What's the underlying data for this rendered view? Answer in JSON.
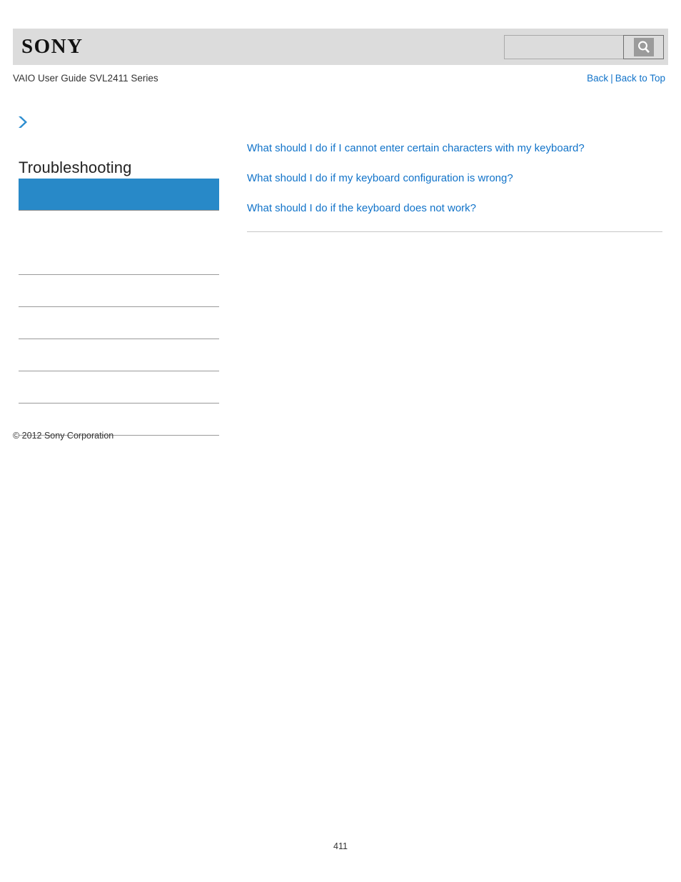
{
  "header": {
    "logo_text": "SONY",
    "logo_icon": "sony-wordmark",
    "search": {
      "value": "",
      "placeholder": "",
      "icon": "search-icon",
      "button_label": ""
    }
  },
  "subheader": {
    "guide_title": "VAIO User Guide SVL2411 Series",
    "back_label": "Back",
    "separator": "|",
    "back_to_top_label": "Back to Top"
  },
  "sidebar": {
    "breadcrumb_icon": "double-chevron-right-icon",
    "section_title": "Troubleshooting",
    "items": [
      {
        "label": "",
        "selected": true
      },
      {
        "label": "",
        "selected": false
      },
      {
        "label": "",
        "selected": false
      },
      {
        "label": "",
        "selected": false
      },
      {
        "label": "",
        "selected": false
      },
      {
        "label": "",
        "selected": false
      },
      {
        "label": "",
        "selected": false
      },
      {
        "label": "",
        "selected": false
      }
    ]
  },
  "main": {
    "links": [
      "What should I do if I cannot enter certain characters with my keyboard?",
      "What should I do if my keyboard configuration is wrong?",
      "What should I do if the keyboard does not work?"
    ]
  },
  "footer": {
    "copyright": "© 2012 Sony Corporation",
    "page_number": "411"
  },
  "colors": {
    "accent_blue": "#2889c8",
    "link_blue": "#1173c9",
    "header_gray": "#dcdcdc",
    "rule_gray": "#9a9a9a"
  }
}
